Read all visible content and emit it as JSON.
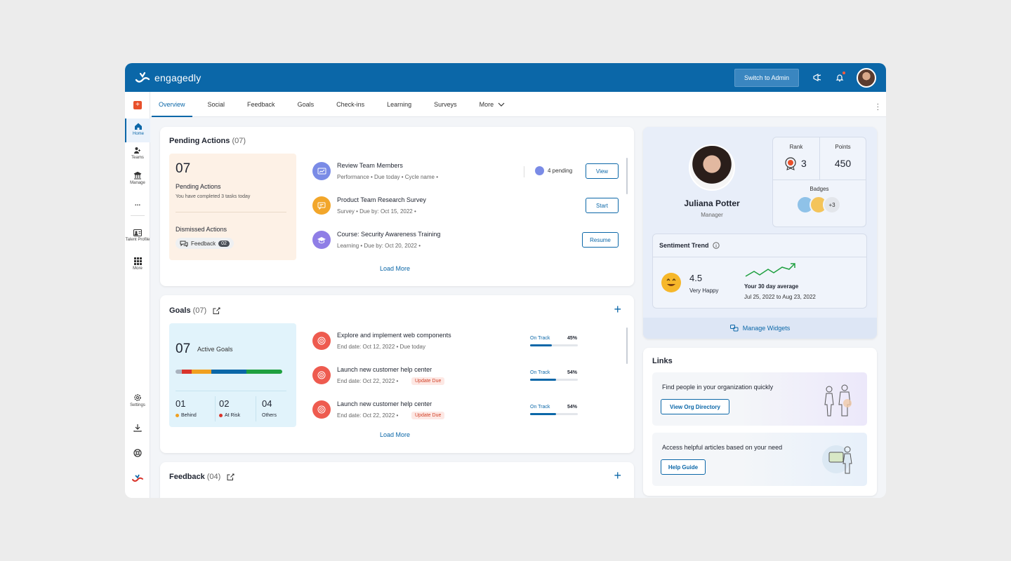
{
  "app": {
    "name": "engagedly",
    "admin_button": "Switch to Admin"
  },
  "sidebar": {
    "items": [
      {
        "label": "Home",
        "icon": "home-icon"
      },
      {
        "label": "Teams",
        "icon": "teams-icon"
      },
      {
        "label": "Manage",
        "icon": "manage-icon"
      },
      {
        "label": "...",
        "icon": "more-dots-icon"
      },
      {
        "label": "Talent Profile",
        "icon": "talent-profile-icon"
      },
      {
        "label": "More",
        "icon": "grid-icon"
      },
      {
        "label": "Settings",
        "icon": "gear-icon"
      }
    ]
  },
  "tabs": [
    "Overview",
    "Social",
    "Feedback",
    "Goals",
    "Check-ins",
    "Learning",
    "Surveys",
    "More"
  ],
  "pending": {
    "title": "Pending Actions",
    "count": "(07)",
    "summary": {
      "number": "07",
      "label": "Pending Actions",
      "sub": "You have completed 3 tasks today",
      "dismissed": "Dismissed Actions",
      "chip": "Feedback",
      "chip_count": "02"
    },
    "items": [
      {
        "title": "Review Team Members",
        "meta": "Performance  •  Due today  •  Cycle name  •",
        "button": "View",
        "extra": "4 pending"
      },
      {
        "title": "Product Team Research Survey",
        "meta": "Survey  •  Due by: Oct 15, 2022  •",
        "button": "Start"
      },
      {
        "title": "Course: Security Awareness Training",
        "meta": "Learning  •  Due by: Oct 20, 2022      •",
        "button": "Resume"
      }
    ],
    "load_more": "Load More"
  },
  "goals": {
    "title": "Goals",
    "count": "(07)",
    "summary": {
      "number": "07",
      "label": "Active Goals",
      "stats": [
        {
          "n": "01",
          "label": "Behind"
        },
        {
          "n": "02",
          "label": "At Risk"
        },
        {
          "n": "04",
          "label": "Others"
        }
      ]
    },
    "items": [
      {
        "title": "Explore and implement web components",
        "meta": "End date: Oct 12, 2022  •  Due today",
        "status": "On Track",
        "pct": "45%",
        "progress": 0.45,
        "badge": ""
      },
      {
        "title": "Launch new customer help center",
        "meta": "End date: Oct 22, 2022  •",
        "status": "On Track",
        "pct": "54%",
        "progress": 0.54,
        "badge": "Update Due"
      },
      {
        "title": "Launch new customer help center",
        "meta": "End date: Oct 22, 2022  •",
        "status": "On Track",
        "pct": "54%",
        "progress": 0.54,
        "badge": "Update Due"
      }
    ],
    "load_more": "Load More"
  },
  "feedback": {
    "title": "Feedback",
    "count": "(04)"
  },
  "profile": {
    "name": "Juliana Potter",
    "role": "Manager",
    "rank_label": "Rank",
    "rank": "3",
    "points_label": "Points",
    "points": "450",
    "badges_label": "Badges",
    "badges_more": "+3"
  },
  "sentiment": {
    "title": "Sentiment Trend",
    "score": "4.5",
    "mood": "Very Happy",
    "avg_label": "Your 30 day average",
    "range": "Jul 25, 2022 to Aug 23, 2022"
  },
  "manage_widgets": "Manage Widgets",
  "links": {
    "title": "Links",
    "items": [
      {
        "text": "Find people in your organization quickly",
        "button": "View Org Directory"
      },
      {
        "text": "Access helpful articles based on your need",
        "button": "Help Guide"
      }
    ]
  },
  "colors": {
    "brand": "#0b67a8",
    "alert": "#e8502b",
    "behind": "#f0a020",
    "at_risk": "#d9342b",
    "on_track": "#0b67a8"
  }
}
